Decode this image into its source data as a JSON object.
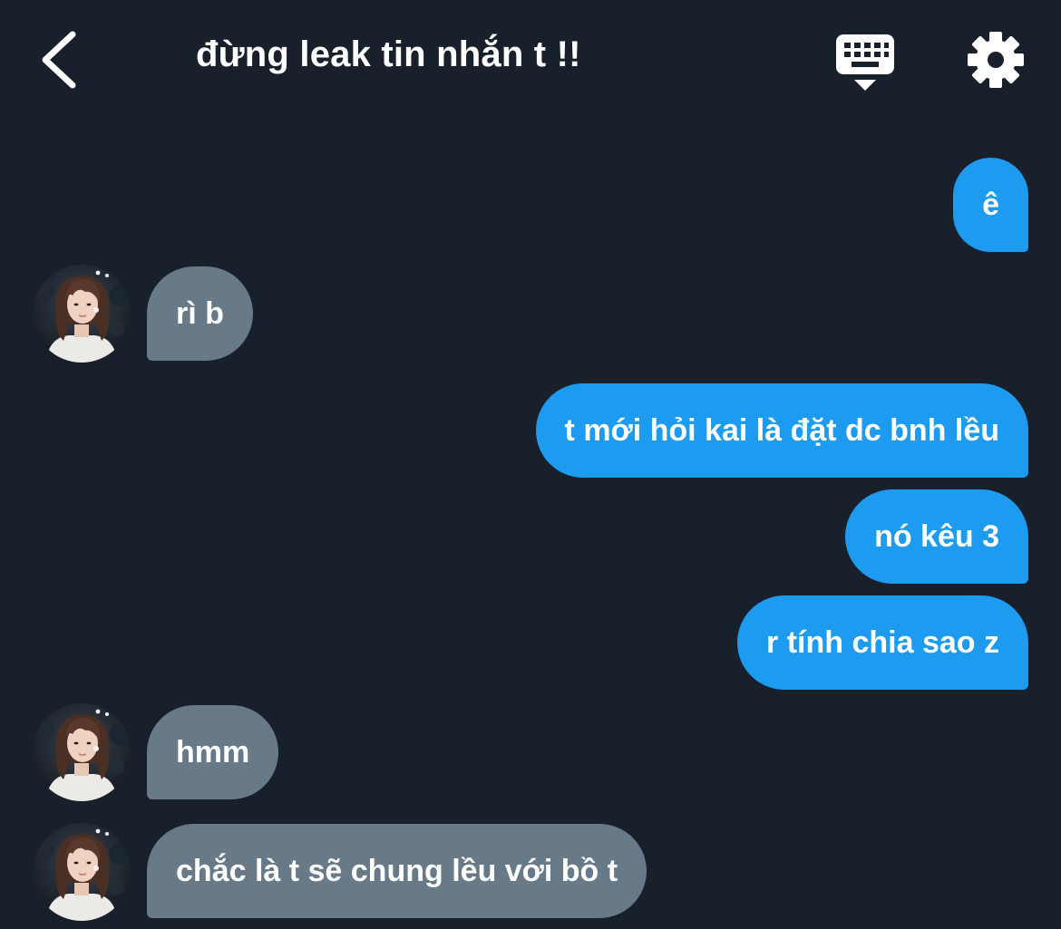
{
  "header": {
    "title": "đừng leak tin nhắn t !!",
    "back_icon": "chevron-left-icon",
    "keyboard_icon": "keyboard-icon",
    "settings_icon": "gear-icon"
  },
  "messages": [
    {
      "direction": "outgoing",
      "text": "ê"
    },
    {
      "direction": "incoming",
      "text": "rì b"
    },
    {
      "direction": "outgoing",
      "text": "t mới hỏi kai là đặt dc bnh lều"
    },
    {
      "direction": "outgoing",
      "text": "nó kêu 3"
    },
    {
      "direction": "outgoing",
      "text": "r tính chia sao z"
    },
    {
      "direction": "incoming",
      "text": "hmm"
    },
    {
      "direction": "incoming",
      "text": "chắc là t sẽ chung lều với bồ t"
    }
  ],
  "colors": {
    "background": "#17202b",
    "outgoing_bubble": "#1d9bf0",
    "incoming_bubble": "#687987",
    "text": "#ffffff"
  }
}
